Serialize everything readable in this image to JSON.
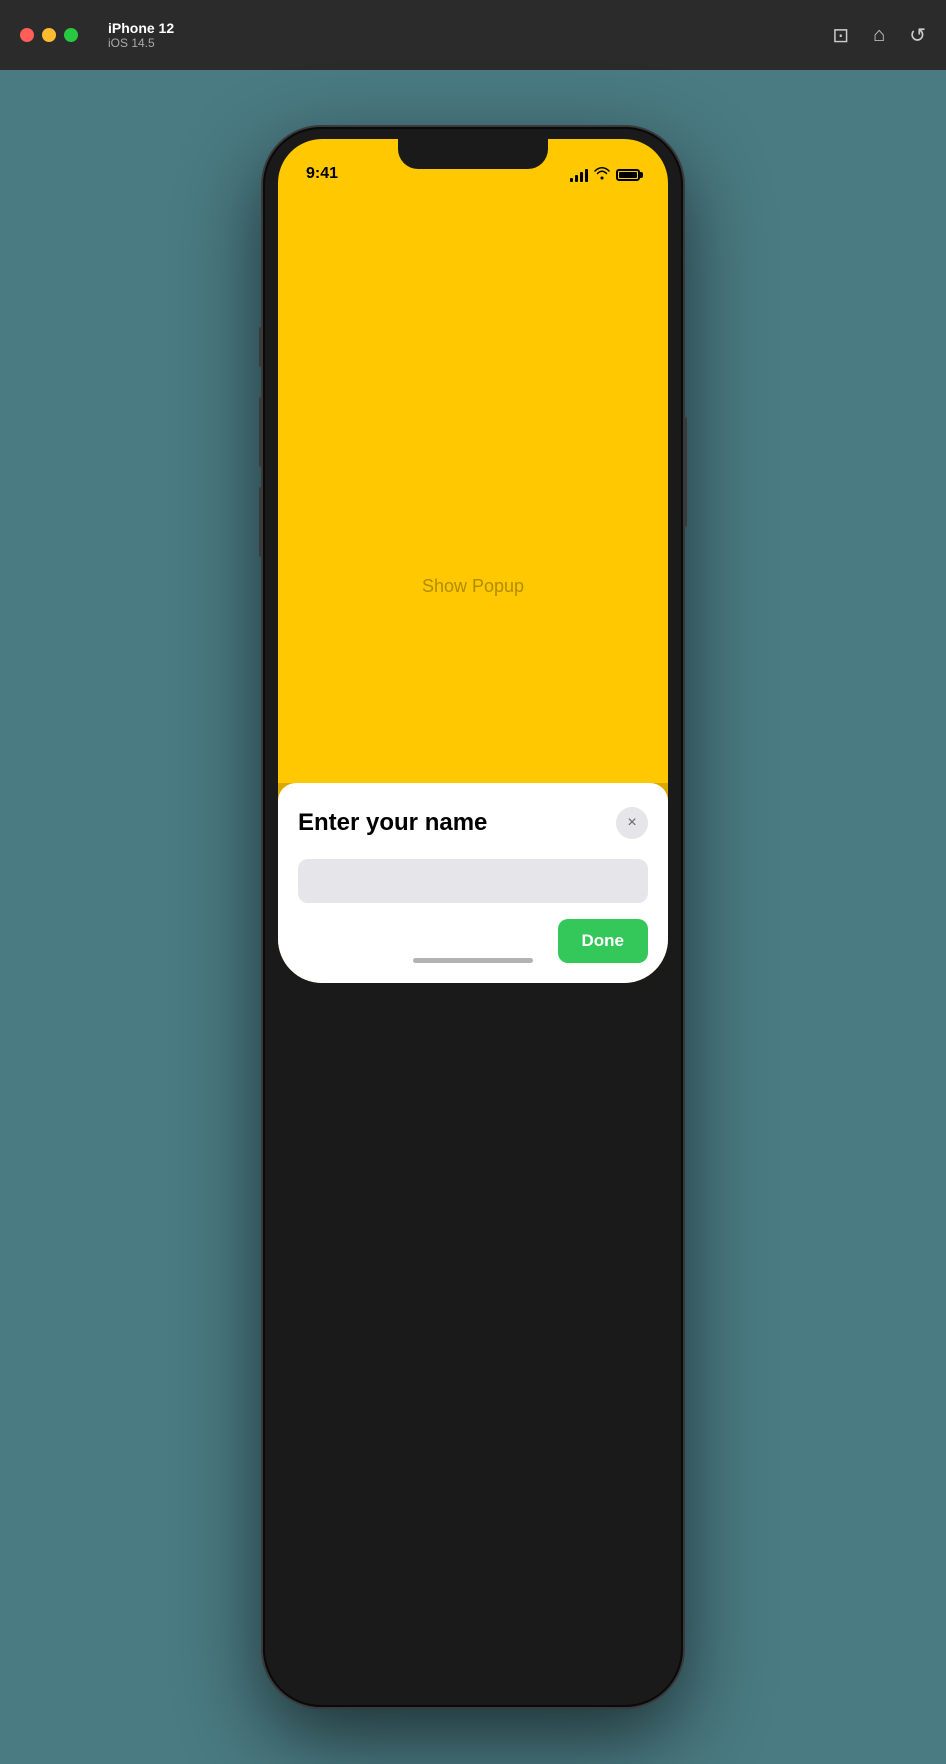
{
  "titlebar": {
    "device_name": "iPhone 12",
    "os_version": "iOS 14.5",
    "icons": [
      "screenshot-icon",
      "home-icon",
      "rotate-icon"
    ]
  },
  "status_bar": {
    "time": "9:41"
  },
  "app": {
    "background_color": "#ffc800",
    "show_popup_label": "Show Popup"
  },
  "modal": {
    "title": "Enter your name",
    "close_label": "×",
    "input_placeholder": "",
    "done_label": "Done"
  }
}
